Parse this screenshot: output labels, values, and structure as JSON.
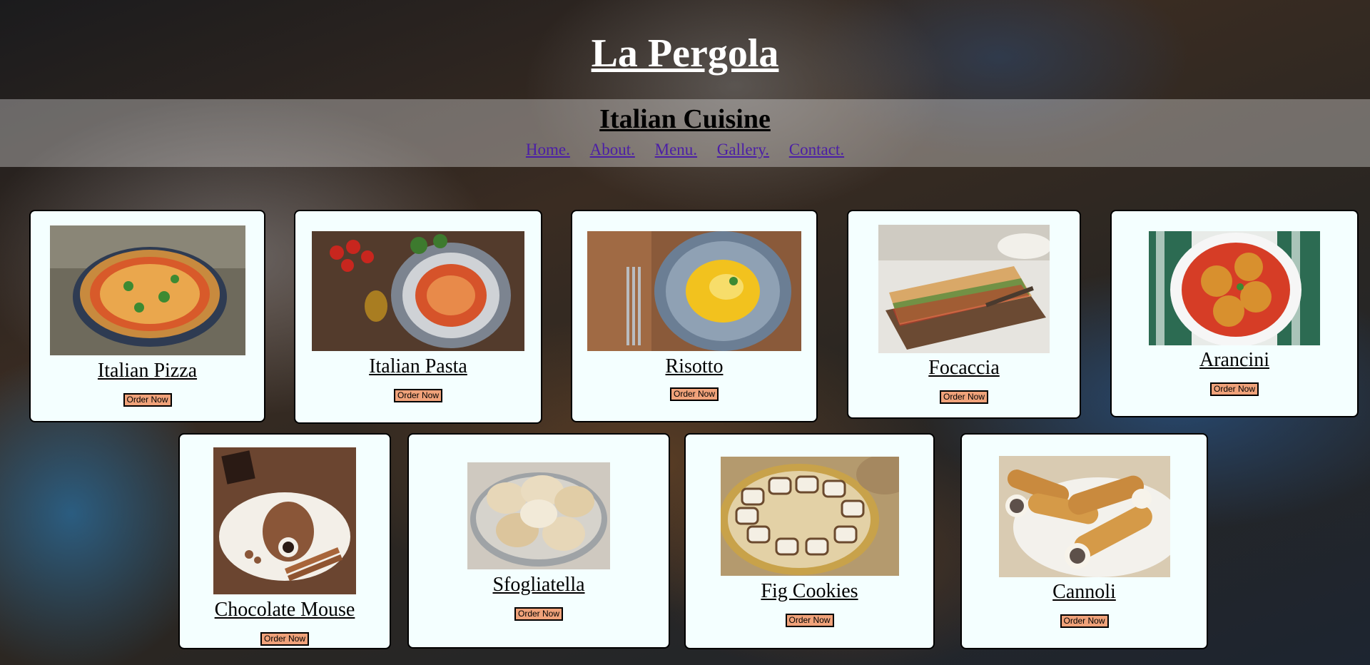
{
  "header": {
    "title": "La Pergola",
    "subtitle": "Italian Cuisine"
  },
  "nav": {
    "items": [
      "Home.",
      "About.",
      "Menu.",
      "Gallery.",
      "Contact."
    ]
  },
  "menu": {
    "items": [
      {
        "name": "Italian Pizza",
        "button": "Order Now"
      },
      {
        "name": "Italian Pasta",
        "button": "Order Now"
      },
      {
        "name": "Risotto",
        "button": "Order Now"
      },
      {
        "name": "Focaccia",
        "button": "Order Now"
      },
      {
        "name": "Arancini",
        "button": "Order Now"
      },
      {
        "name": "Chocolate Mouse",
        "button": "Order Now"
      },
      {
        "name": "Sfogliatella",
        "button": "Order Now"
      },
      {
        "name": "Fig Cookies",
        "button": "Order Now"
      },
      {
        "name": "Cannoli",
        "button": "Order Now"
      }
    ]
  },
  "colors": {
    "card_background": "#f4ffff",
    "button_background": "#f0a27a",
    "nav_link": "#4b1ea6",
    "banner_overlay": "rgba(255,255,255,0.33)"
  }
}
